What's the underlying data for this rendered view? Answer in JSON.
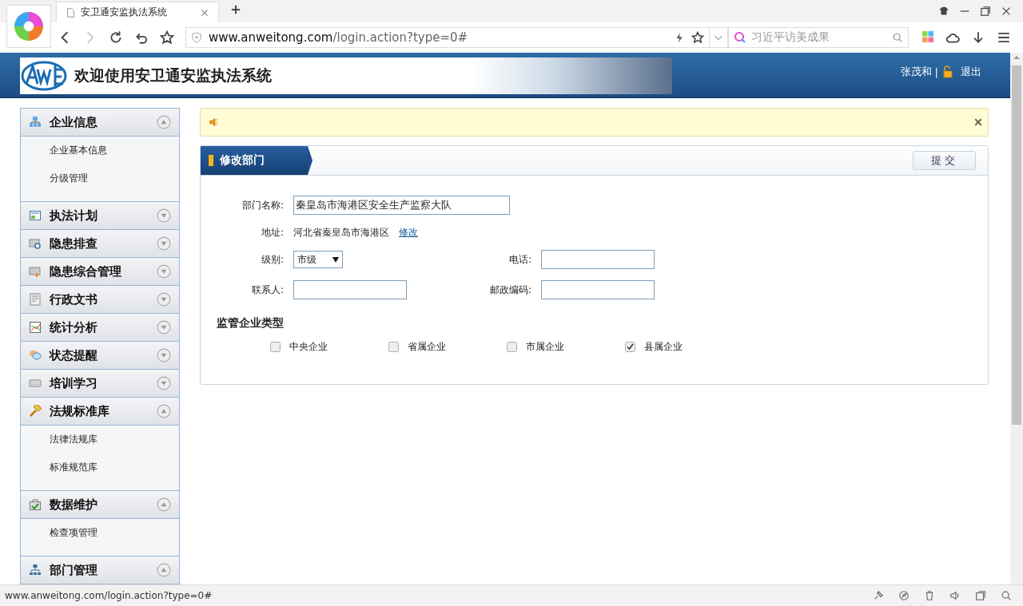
{
  "browser": {
    "tab_title": "安卫通安监执法系统",
    "url_host": "www.anweitong.com",
    "url_path": "/login.action?type=0#",
    "search_placeholder": "习近平访美成果"
  },
  "header": {
    "title": "欢迎使用安卫通安监执法系统",
    "user": "张茂和",
    "separator": "|",
    "logout": "退出"
  },
  "sidebar": {
    "groups": [
      {
        "label": "企业信息",
        "expanded": true,
        "items": [
          "企业基本信息",
          "分级管理"
        ]
      },
      {
        "label": "执法计划",
        "expanded": false
      },
      {
        "label": "隐患排查",
        "expanded": false
      },
      {
        "label": "隐患综合管理",
        "expanded": false
      },
      {
        "label": "行政文书",
        "expanded": false
      },
      {
        "label": "统计分析",
        "expanded": false
      },
      {
        "label": "状态提醒",
        "expanded": false
      },
      {
        "label": "培训学习",
        "expanded": false
      },
      {
        "label": "法规标准库",
        "expanded": true,
        "items": [
          "法律法规库",
          "标准规范库"
        ]
      },
      {
        "label": "数据维护",
        "expanded": true,
        "items": [
          "检查项管理"
        ]
      },
      {
        "label": "部门管理",
        "expanded": true
      }
    ]
  },
  "panel": {
    "title": "修改部门",
    "submit": "提交",
    "form": {
      "name_label": "部门名称:",
      "name_value": "秦皇岛市海港区安全生产监察大队",
      "address_label": "地址:",
      "address_value": "河北省秦皇岛市海港区",
      "address_link": "修改",
      "level_label": "级别:",
      "level_value": "市级",
      "phone_label": "电话:",
      "contact_label": "联系人:",
      "postcode_label": "邮政编码:"
    },
    "section_title": "监管企业类型",
    "checkboxes": [
      {
        "label": "中央企业",
        "checked": false
      },
      {
        "label": "省属企业",
        "checked": false
      },
      {
        "label": "市属企业",
        "checked": false
      },
      {
        "label": "县属企业",
        "checked": true
      }
    ]
  },
  "status_bar": {
    "url": "www.anweitong.com/login.action?type=0#"
  }
}
